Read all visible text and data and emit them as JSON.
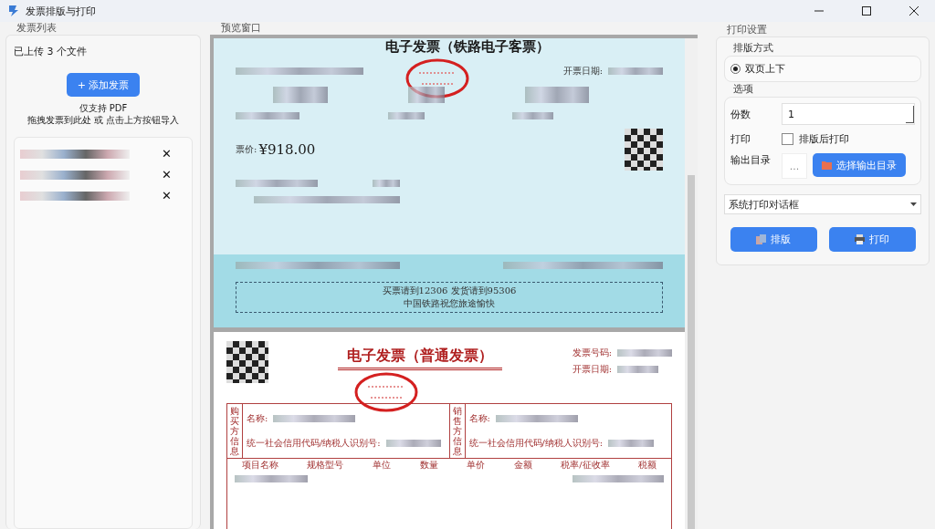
{
  "window": {
    "title": "发票排版与打印"
  },
  "invoice_list": {
    "title": "发票列表",
    "upload_count": "已上传 3 个文件",
    "add_button": "+ 添加发票",
    "hint_lines": [
      "仅支持 PDF",
      "拖拽发票到此处 或 点击上方按钮导入"
    ],
    "files": [
      {
        "remove": "✕"
      },
      {
        "remove": "✕"
      },
      {
        "remove": "✕"
      }
    ]
  },
  "preview": {
    "title": "预览窗口",
    "pages": [
      {
        "kind": "rail",
        "title": "电子发票（铁路电子客票）",
        "date_label": "开票日期:",
        "price_label": "票价:",
        "price": "¥918.00",
        "notice_lines": [
          "买票请到12306  发货请到95306",
          "中国铁路祝您旅途愉快"
        ]
      },
      {
        "kind": "vat",
        "title": "电子发票（普通发票）",
        "number_label": "发票号码:",
        "date_label": "开票日期:",
        "buyer_label": "购买方信息",
        "seller_label": "销售方信息",
        "buyer_name_label": "名称:",
        "buyer_tax_id_label": "统一社会信用代码/纳税人识别号:",
        "seller_name_label": "名称:",
        "seller_tax_id_label": "统一社会信用代码/纳税人识别号:",
        "columns": [
          "项目名称",
          "规格型号",
          "单位",
          "数量",
          "单价",
          "金额",
          "税率/征收率",
          "税额"
        ]
      }
    ]
  },
  "settings": {
    "title": "打印设置",
    "layout_group": {
      "title": "排版方式",
      "options": [
        {
          "label": "双页上下",
          "selected": true
        }
      ]
    },
    "options_group": {
      "title": "选项",
      "copies_label": "份数",
      "copies_value": "1",
      "print_label": "打印",
      "print_after": {
        "label": "排版后打印",
        "checked": false
      },
      "output_label": "输出目录",
      "output_path": "...",
      "choose_button": "选择输出目录"
    },
    "printer_select": "系统打印对话框",
    "buttons": [
      {
        "kind": "layout",
        "label": "排版"
      },
      {
        "kind": "print",
        "label": "打印"
      }
    ]
  }
}
